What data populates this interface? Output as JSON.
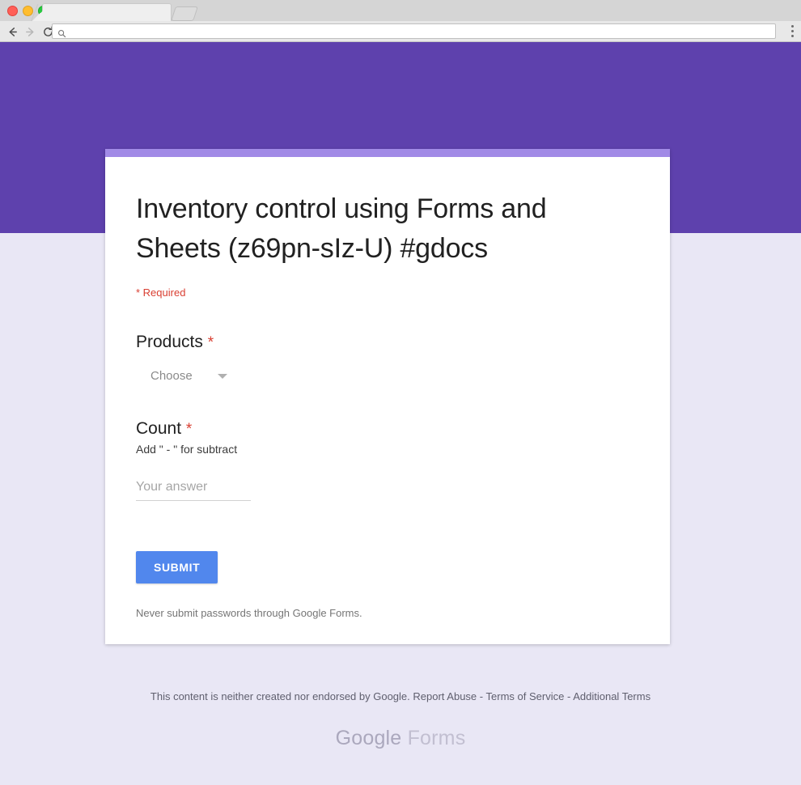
{
  "browser": {
    "tab_title": "",
    "newtab_label": "",
    "nav": {
      "back_icon": "back-arrow-icon",
      "forward_icon": "forward-arrow-icon",
      "reload_icon": "reload-icon",
      "menu_icon": "three-dot-menu-icon"
    },
    "omnibox": {
      "value": "",
      "placeholder": "",
      "icon": "search-icon"
    }
  },
  "colors": {
    "hero_purple": "#5e41ad",
    "card_stripe_purple": "#a18ae6",
    "page_background": "#e9e7f5",
    "required_red": "#d93f32",
    "submit_blue": "#5187ed"
  },
  "form": {
    "title": "Inventory control using Forms and Sheets (z69pn-sIz-U) #gdocs",
    "required_note": "* Required",
    "questions": [
      {
        "label": "Products",
        "required_marker": "*",
        "help": "",
        "type": "dropdown",
        "selected_value": "Choose",
        "caret_icon": "chevron-down-icon"
      },
      {
        "label": "Count",
        "required_marker": "*",
        "help": "Add \" - \" for subtract",
        "type": "short-answer",
        "value": "",
        "placeholder": "Your answer"
      }
    ],
    "submit_label": "SUBMIT",
    "passwords_note": "Never submit passwords through Google Forms."
  },
  "footer": {
    "disclaimer_text": "This content is neither created nor endorsed by Google.",
    "report_abuse": "Report Abuse",
    "separator_1": "-",
    "terms_of_service": "Terms of Service",
    "separator_2": "-",
    "additional_terms": "Additional Terms",
    "brand_google": "Google",
    "brand_forms": "Forms"
  }
}
